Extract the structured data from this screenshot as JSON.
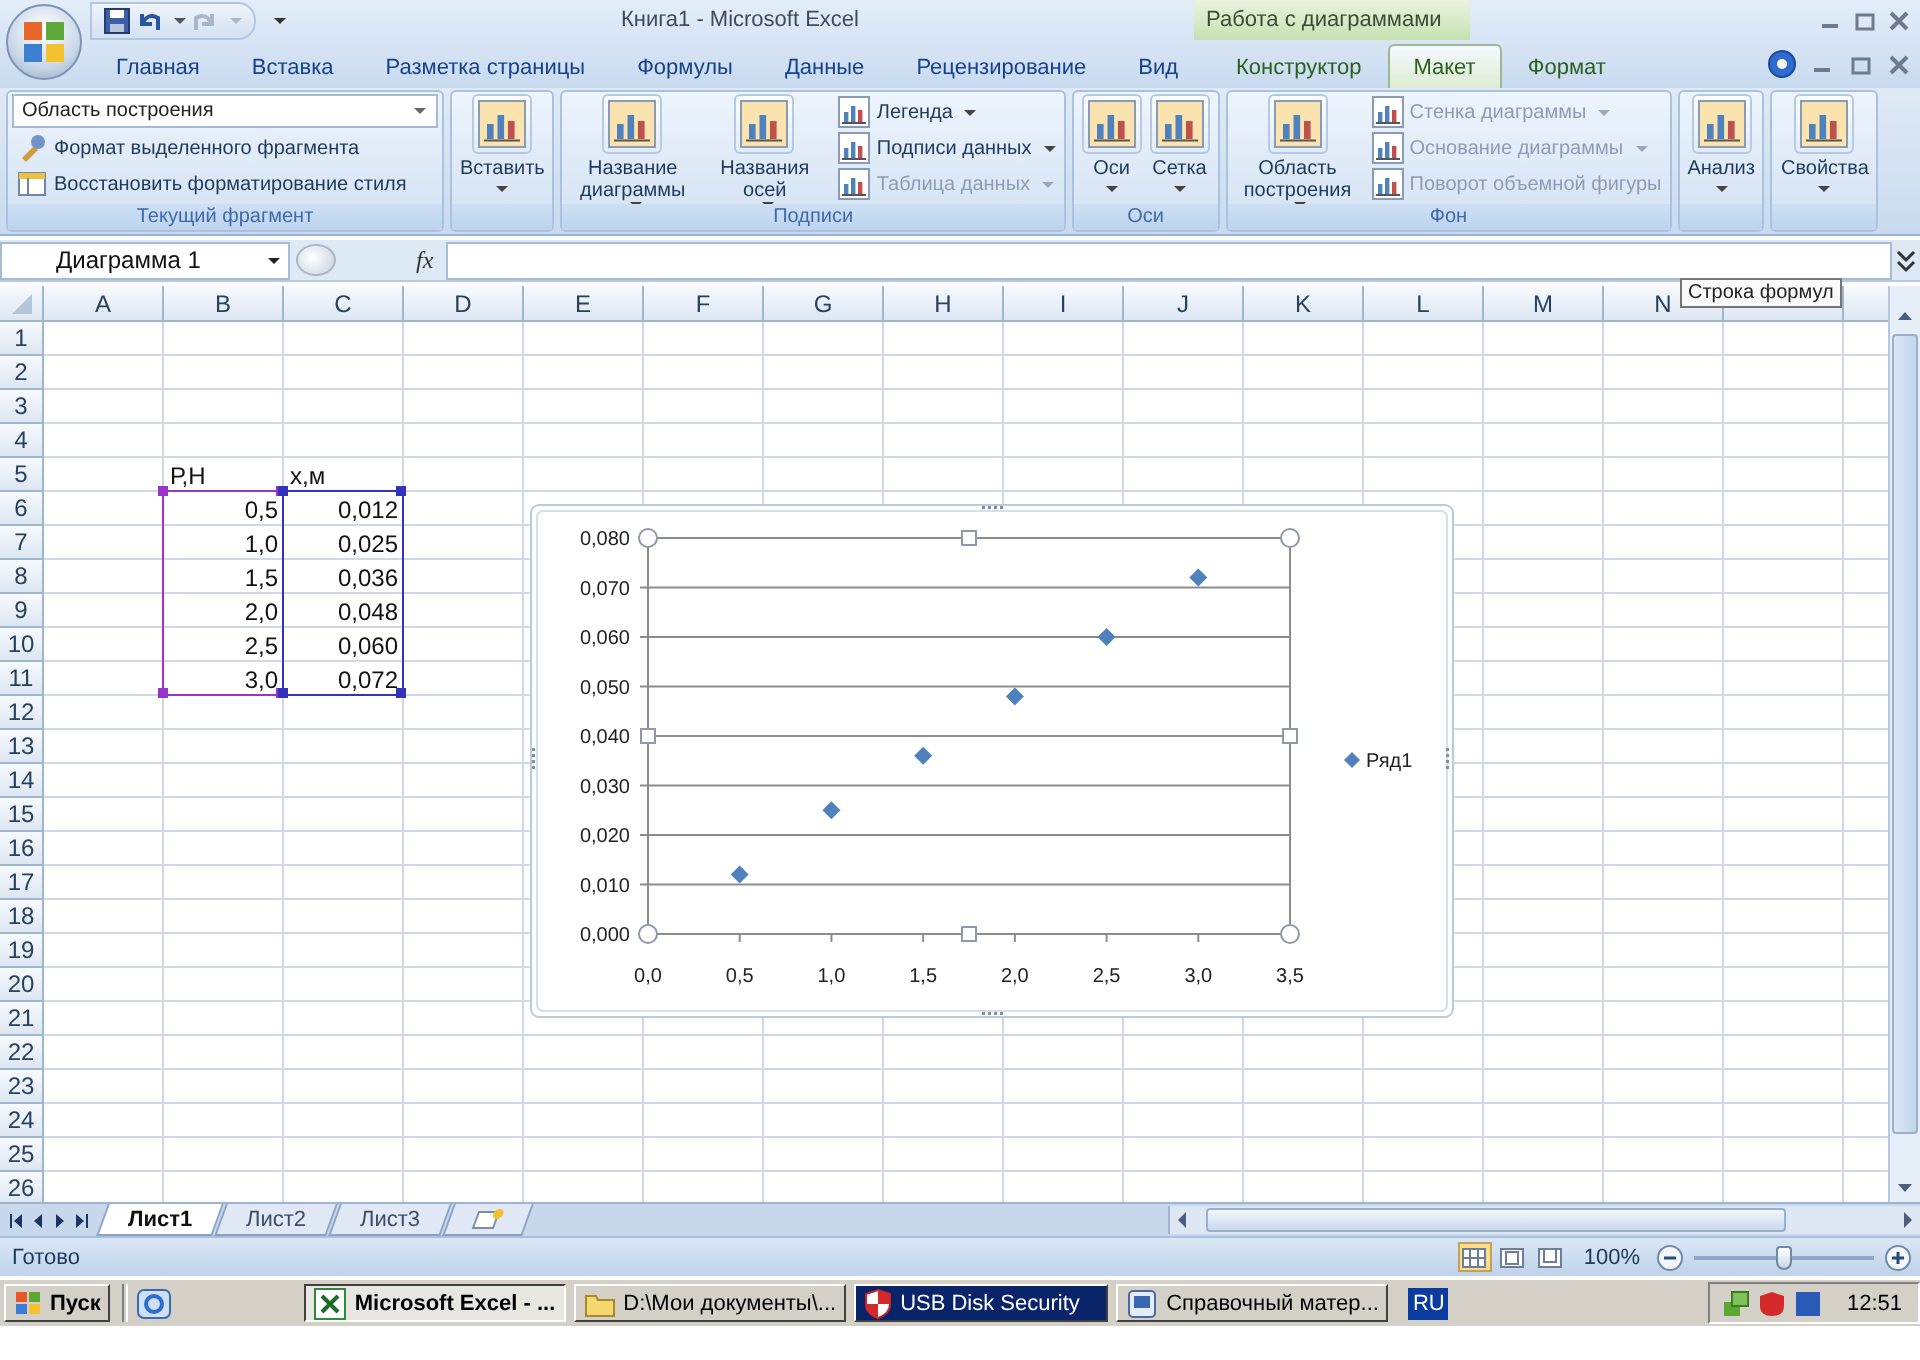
{
  "title_bar": {
    "title": "Книга1 - Microsoft Excel",
    "context_group": "Работа с диаграммами"
  },
  "tabs": [
    {
      "label": "Главная",
      "selected": false,
      "contextual": false
    },
    {
      "label": "Вставка",
      "selected": false,
      "contextual": false
    },
    {
      "label": "Разметка страницы",
      "selected": false,
      "contextual": false
    },
    {
      "label": "Формулы",
      "selected": false,
      "contextual": false
    },
    {
      "label": "Данные",
      "selected": false,
      "contextual": false
    },
    {
      "label": "Рецензирование",
      "selected": false,
      "contextual": false
    },
    {
      "label": "Вид",
      "selected": false,
      "contextual": false
    },
    {
      "label": "Конструктор",
      "selected": false,
      "contextual": true
    },
    {
      "label": "Макет",
      "selected": true,
      "contextual": true
    },
    {
      "label": "Формат",
      "selected": false,
      "contextual": true
    }
  ],
  "ribbon": {
    "groups": [
      {
        "kind": "fragment",
        "label": "Текущий фрагмент",
        "selector": "Область построения",
        "commands": [
          {
            "label": "Формат выделенного фрагмента",
            "disabled": false
          },
          {
            "label": "Восстановить форматирование стиля",
            "disabled": false
          }
        ]
      },
      {
        "kind": "buttons",
        "big": [
          {
            "label": "Вставить",
            "dropdown": true
          }
        ]
      },
      {
        "kind": "buttons",
        "label": "Подписи",
        "big": [
          {
            "label": "Название диаграммы",
            "dropdown": true
          },
          {
            "label": "Названия осей",
            "dropdown": true
          }
        ],
        "small": [
          {
            "label": "Легенда",
            "dropdown": true,
            "disabled": false
          },
          {
            "label": "Подписи данных",
            "dropdown": true,
            "disabled": false
          },
          {
            "label": "Таблица данных",
            "dropdown": true,
            "disabled": true
          }
        ]
      },
      {
        "kind": "buttons",
        "label": "Оси",
        "big": [
          {
            "label": "Оси",
            "dropdown": true
          },
          {
            "label": "Сетка",
            "dropdown": true
          }
        ]
      },
      {
        "kind": "buttons",
        "label": "Фон",
        "big": [
          {
            "label": "Область построения",
            "dropdown": true
          }
        ],
        "small": [
          {
            "label": "Стенка диаграммы",
            "dropdown": true,
            "disabled": true
          },
          {
            "label": "Основание диаграммы",
            "dropdown": true,
            "disabled": true
          },
          {
            "label": "Поворот объемной фигуры",
            "dropdown": false,
            "disabled": true
          }
        ]
      },
      {
        "kind": "buttons",
        "big": [
          {
            "label": "Анализ",
            "dropdown": true
          }
        ]
      },
      {
        "kind": "buttons",
        "big": [
          {
            "label": "Свойства",
            "dropdown": true
          }
        ]
      }
    ]
  },
  "formula_bar": {
    "name_box": "Диаграмма 1",
    "function_label": "fx",
    "tooltip": "Строка формул"
  },
  "sheet": {
    "columns": [
      "A",
      "B",
      "C",
      "D",
      "E",
      "F",
      "G",
      "H",
      "I",
      "J",
      "K",
      "L",
      "M",
      "N"
    ],
    "rows": [
      "1",
      "2",
      "3",
      "4",
      "5",
      "6",
      "7",
      "8",
      "9",
      "10",
      "11",
      "12",
      "13",
      "14",
      "15",
      "16",
      "17",
      "18",
      "19",
      "20",
      "21",
      "22",
      "23",
      "24",
      "25",
      "26"
    ],
    "data_columns": [
      {
        "header": "Р,Н",
        "values": [
          "0,5",
          "1,0",
          "1,5",
          "2,0",
          "2,5",
          "3,0"
        ],
        "color": "#9933cc"
      },
      {
        "header": "x,м",
        "values": [
          "0,012",
          "0,025",
          "0,036",
          "0,048",
          "0,060",
          "0,072"
        ],
        "color": "#3333bb"
      }
    ],
    "chart": {
      "chart_data": {
        "type": "scatter",
        "x": [
          0.5,
          1.0,
          1.5,
          2.0,
          2.5,
          3.0
        ],
        "series": [
          {
            "name": "Ряд1",
            "color": "#4f81bd",
            "values": [
              0.012,
              0.025,
              0.036,
              0.048,
              0.06,
              0.072
            ]
          }
        ],
        "xlim": [
          0,
          3.5
        ],
        "ylim": [
          0,
          0.08
        ],
        "grid": true,
        "xticks": [
          {
            "value": 0,
            "label": "0,0"
          },
          {
            "value": 0.5,
            "label": "0,5"
          },
          {
            "value": 1,
            "label": "1,0"
          },
          {
            "value": 1.5,
            "label": "1,5"
          },
          {
            "value": 2,
            "label": "2,0"
          },
          {
            "value": 2.5,
            "label": "2,5"
          },
          {
            "value": 3,
            "label": "3,0"
          },
          {
            "value": 3.5,
            "label": "3,5"
          }
        ],
        "yticks": [
          {
            "value": 0,
            "label": "0,000"
          },
          {
            "value": 0.01,
            "label": "0,010"
          },
          {
            "value": 0.02,
            "label": "0,020"
          },
          {
            "value": 0.03,
            "label": "0,030"
          },
          {
            "value": 0.04,
            "label": "0,040"
          },
          {
            "value": 0.05,
            "label": "0,050"
          },
          {
            "value": 0.06,
            "label": "0,060"
          },
          {
            "value": 0.07,
            "label": "0,070"
          },
          {
            "value": 0.08,
            "label": "0,080"
          }
        ]
      }
    }
  },
  "sheet_tabs": [
    {
      "label": "Лист1",
      "selected": true
    },
    {
      "label": "Лист2",
      "selected": false
    },
    {
      "label": "Лист3",
      "selected": false
    }
  ],
  "status_bar": {
    "text": "Готово",
    "views": [
      {
        "kind": "normal",
        "selected": true
      },
      {
        "kind": "layout",
        "selected": false
      },
      {
        "kind": "page-break",
        "selected": false
      }
    ],
    "zoom": "100%",
    "zoom_slider": {
      "level": 0.5
    }
  },
  "taskbar": {
    "start": "Пуск",
    "tasks": [
      {
        "label": "Microsoft Excel - ...",
        "kind": "spreadsheet",
        "selected": true,
        "flashing": false
      },
      {
        "label": "D:\\Мои документы\\...",
        "kind": "folder",
        "selected": false,
        "flashing": false
      },
      {
        "label": "USB Disk Security",
        "kind": "shield",
        "selected": false,
        "flashing": true
      },
      {
        "label": "Справочный матер...",
        "kind": "document",
        "selected": false,
        "flashing": false
      }
    ],
    "language": "RU",
    "clock": "12:51"
  }
}
